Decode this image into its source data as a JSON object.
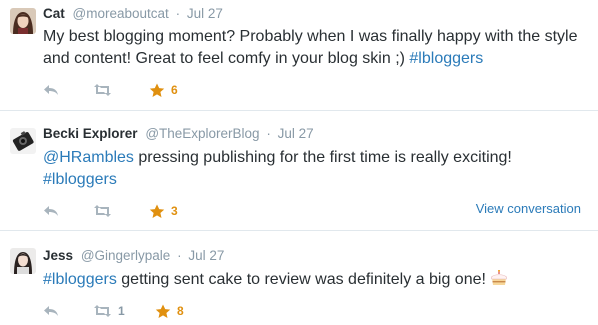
{
  "tweets": [
    {
      "name": "Cat",
      "handle": "@moreaboutcat",
      "time": "Jul 27",
      "text_before": "My best blogging moment? Probably when I was finally happy with the style and content! Great to feel comfy in your blog skin ;) ",
      "hashtag": "#lbloggers",
      "favorites": "6",
      "retweets": "",
      "avatar_icon": "avatar-photo-woman"
    },
    {
      "name": "Becki Explorer",
      "handle": "@TheExplorerBlog",
      "time": "Jul 27",
      "mention": "@HRambles",
      "text_after_mention": " pressing publishing for the first time is really exciting!",
      "hashtag": "#lbloggers",
      "favorites": "3",
      "retweets": "",
      "view_conversation": "View conversation",
      "avatar_icon": "avatar-camera"
    },
    {
      "name": "Jess",
      "handle": "@Gingerlypale",
      "time": "Jul 27",
      "hashtag": "#lbloggers",
      "text_after_hashtag": " getting sent cake to review was definitely a big one! ",
      "emoji_icon": "cake-icon",
      "favorites": "8",
      "retweets": "1",
      "avatar_icon": "avatar-photo-woman-dark"
    }
  ],
  "separator": "·",
  "colors": {
    "link": "#2b7bb9",
    "star": "#e0900f",
    "muted": "#8899a6",
    "text": "#292f33",
    "divider": "#e1e8ed"
  }
}
